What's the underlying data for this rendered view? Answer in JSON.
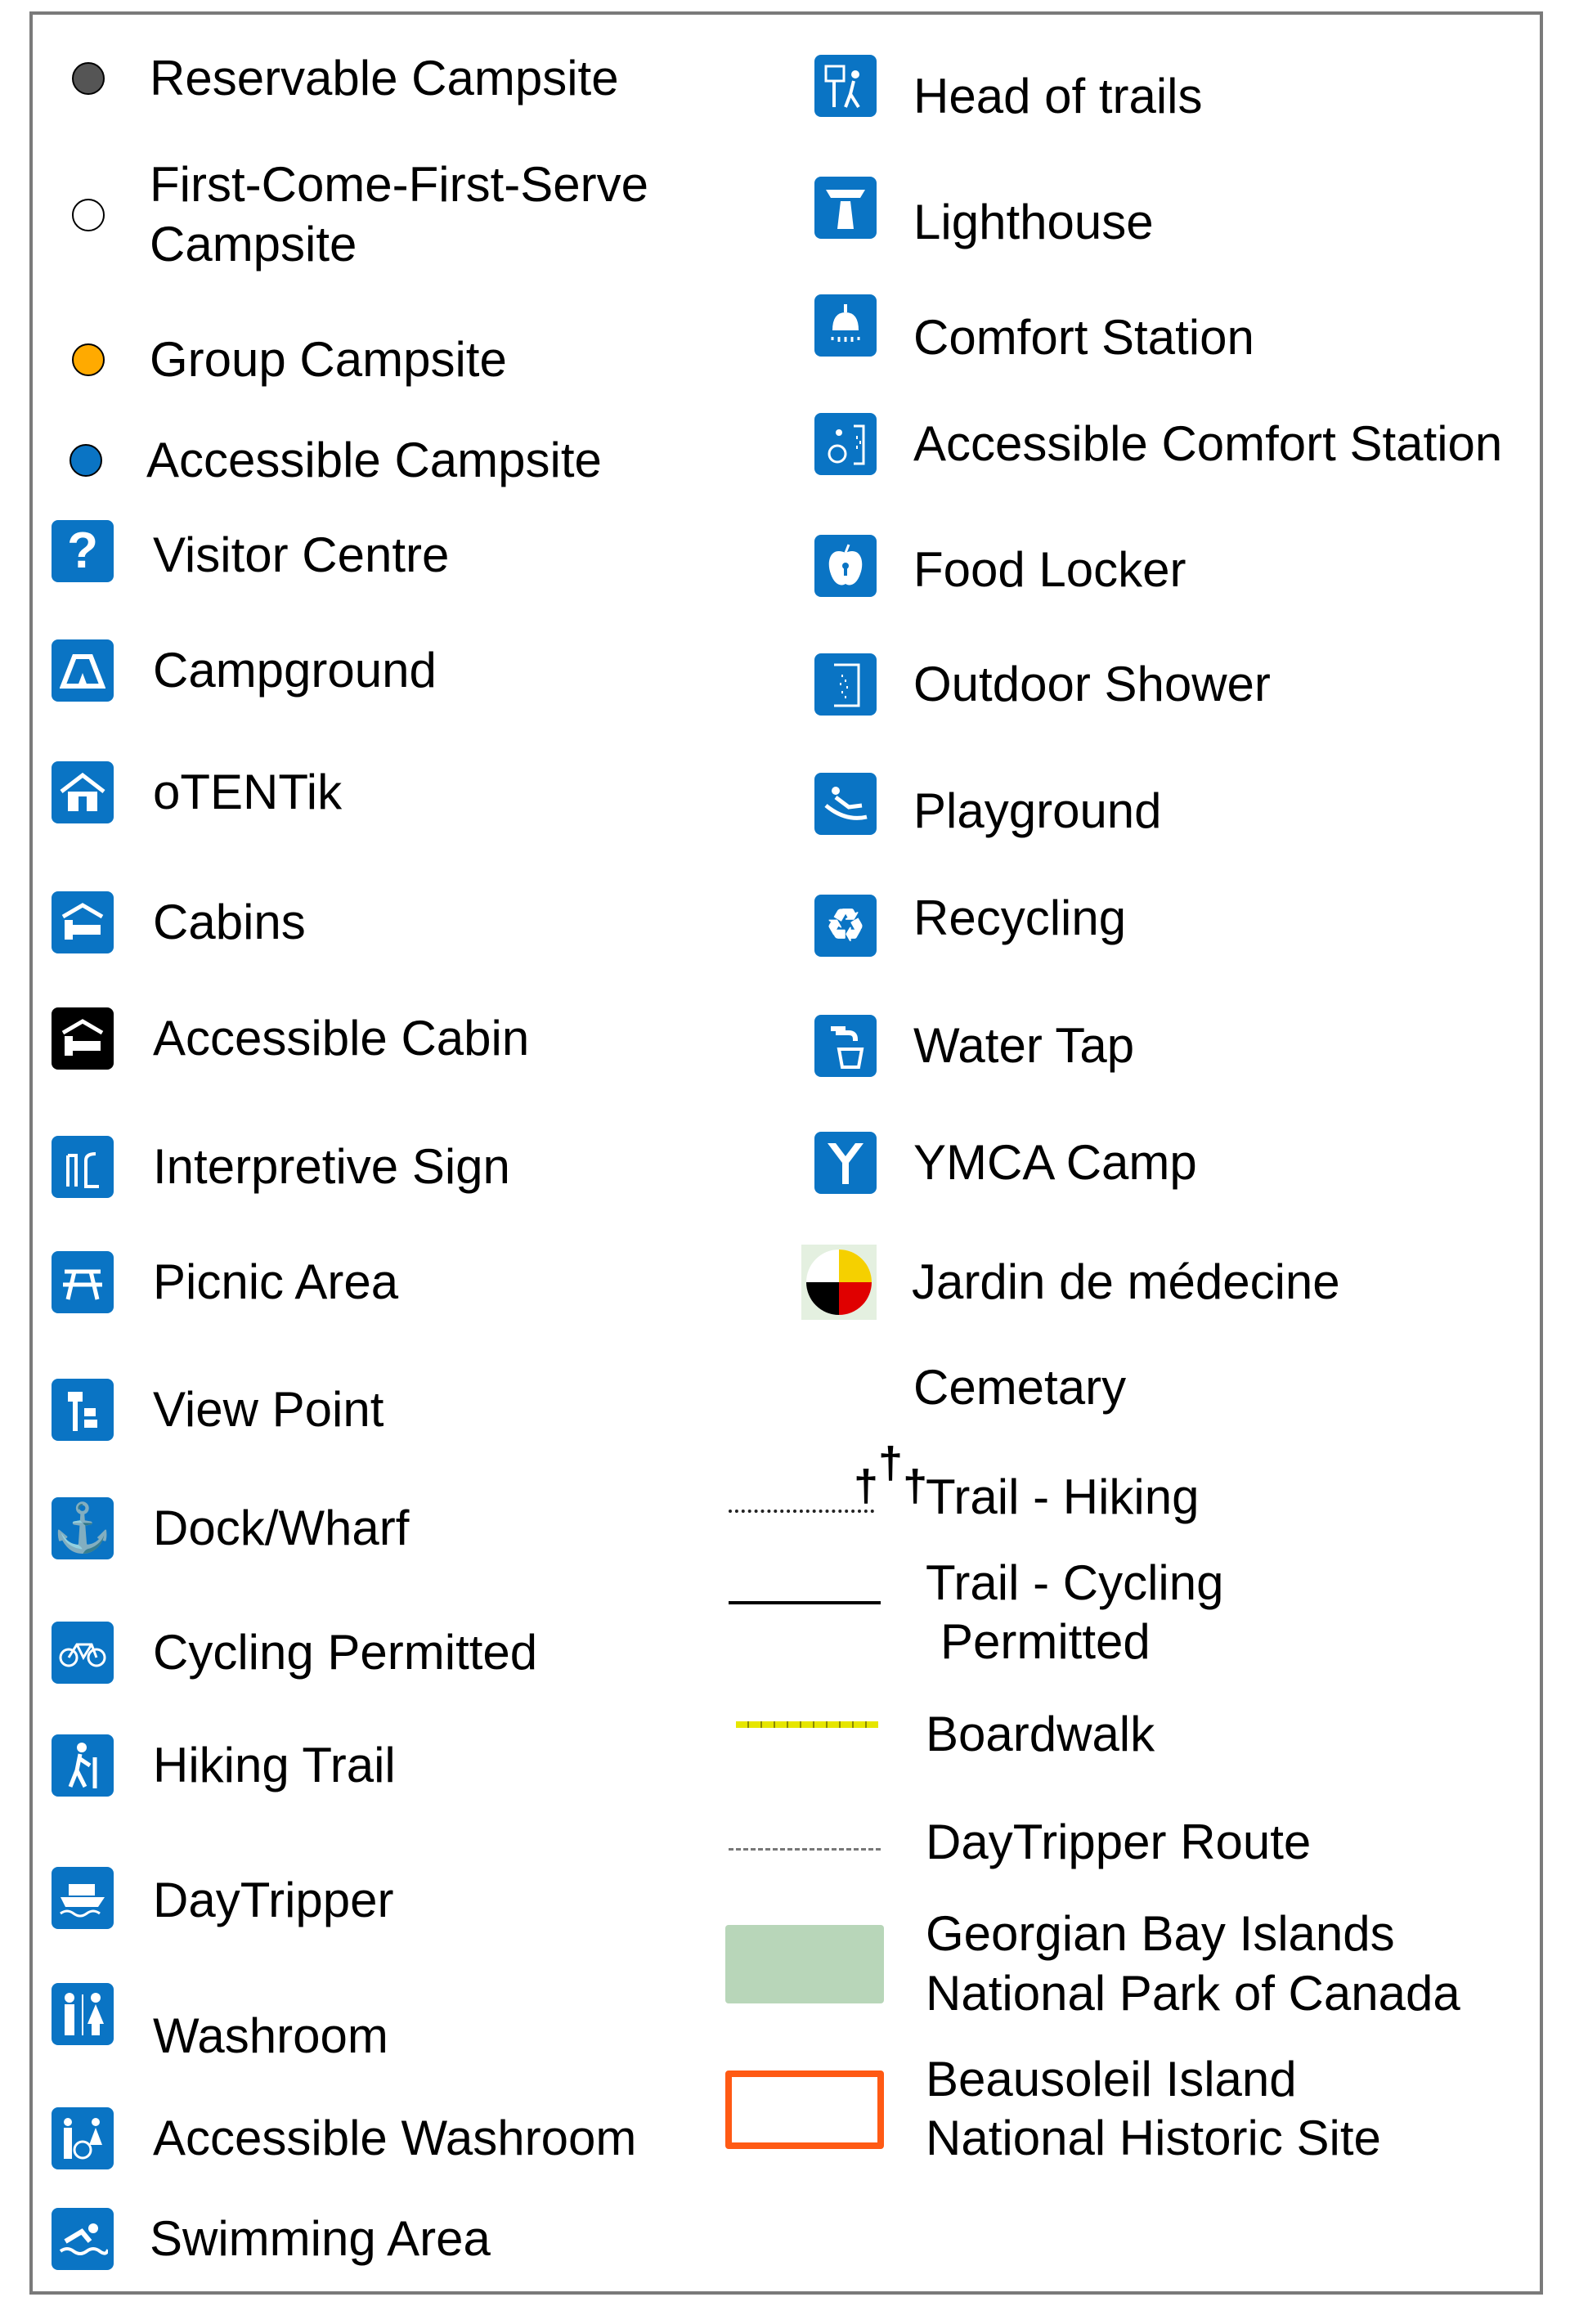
{
  "colors": {
    "icon_blue": "#0a74c4",
    "reservable": "#555555",
    "group": "#ffaa00",
    "accessible": "#0a74c4",
    "park_fill": "#b8d6b9",
    "historic_outline": "#ff5a14",
    "boardwalk": "#e6e600"
  },
  "left": [
    {
      "label": "Reservable Campsite",
      "icon": "dark-circle"
    },
    {
      "label": "First-Come-First-Serve",
      "label2": "Campsite",
      "icon": "white-circle"
    },
    {
      "label": "Group Campsite",
      "icon": "orange-circle"
    },
    {
      "label": "Accessible Campsite",
      "icon": "blue-circle"
    },
    {
      "label": "Visitor Centre",
      "icon": "question-icon"
    },
    {
      "label": "Campground",
      "icon": "tent-icon"
    },
    {
      "label": "oTENTik",
      "icon": "otentik-icon"
    },
    {
      "label": "Cabins",
      "icon": "cabin-icon"
    },
    {
      "label": "Accessible Cabin",
      "icon": "accessible-cabin-icon"
    },
    {
      "label": "Interpretive Sign",
      "icon": "interpretive-sign-icon"
    },
    {
      "label": "Picnic Area",
      "icon": "picnic-table-icon"
    },
    {
      "label": "View Point",
      "icon": "viewpoint-icon"
    },
    {
      "label": "Dock/Wharf",
      "icon": "anchor-icon"
    },
    {
      "label": "Cycling Permitted",
      "icon": "bicycle-icon"
    },
    {
      "label": "Hiking Trail",
      "icon": "hiker-icon"
    },
    {
      "label": "DayTripper",
      "icon": "boat-icon"
    },
    {
      "label": "Washroom",
      "icon": "washroom-icon"
    },
    {
      "label": "Accessible Washroom",
      "icon": "accessible-washroom-icon"
    },
    {
      "label": "Swimming Area",
      "icon": "swimmer-icon"
    }
  ],
  "right": [
    {
      "label": "Head of trails",
      "icon": "trailhead-icon"
    },
    {
      "label": "Lighthouse",
      "icon": "lighthouse-icon"
    },
    {
      "label": "Comfort Station",
      "icon": "shower-icon"
    },
    {
      "label": "Accessible Comfort Station",
      "icon": "accessible-comfort-station-icon"
    },
    {
      "label": "Food Locker",
      "icon": "food-locker-icon"
    },
    {
      "label": "Outdoor Shower",
      "icon": "outdoor-shower-icon"
    },
    {
      "label": "Playground",
      "icon": "slide-icon"
    },
    {
      "label": "Recycling",
      "icon": "recycling-icon"
    },
    {
      "label": "Water Tap",
      "icon": "water-tap-icon"
    },
    {
      "label": "YMCA Camp",
      "icon": "ymca-icon"
    },
    {
      "label": "Jardin de médecine",
      "icon": "medicine-wheel-icon"
    },
    {
      "label": "Cemetary",
      "icon": "crosses-icon"
    },
    {
      "label": "Trail - Hiking",
      "icon": "dotted-line"
    },
    {
      "label": "Trail - Cycling",
      "label2": "Permitted",
      "icon": "solid-line"
    },
    {
      "label": "Boardwalk",
      "icon": "yellow-ticked-line"
    },
    {
      "label": "DayTripper Route",
      "icon": "dashed-line"
    },
    {
      "label": "Georgian Bay Islands",
      "label2": "National Park of Canada",
      "icon": "green-area"
    },
    {
      "label": "Beausoleil Island",
      "label2": "National Historic Site",
      "icon": "orange-outline"
    }
  ]
}
